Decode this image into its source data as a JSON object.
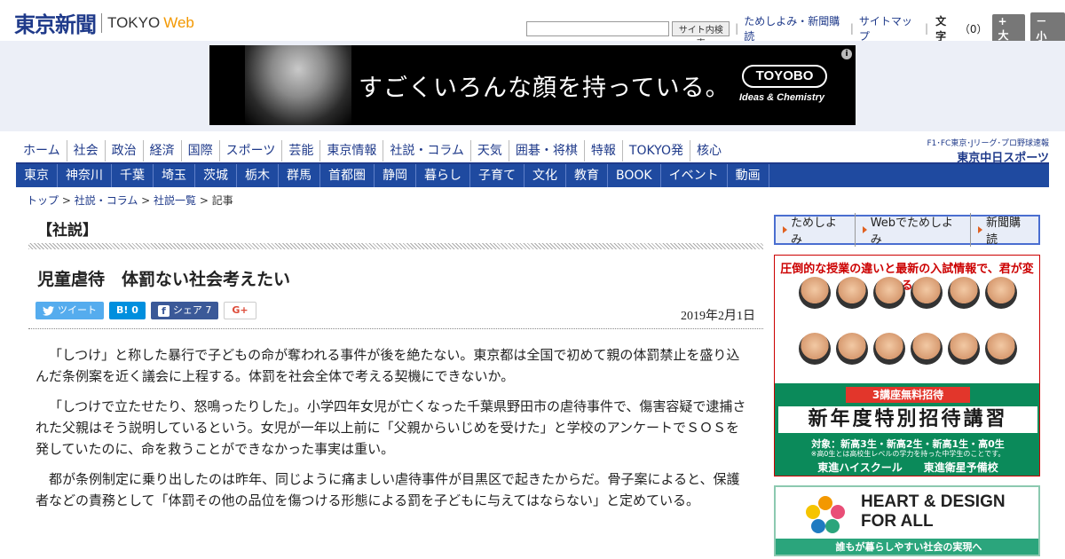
{
  "header": {
    "logo_jp": "東京新聞",
    "logo_tokyo": "TOKYO",
    "logo_web": "Web",
    "search_placeholder": "",
    "search_button": "サイト内検索",
    "links": [
      "ためしよみ・新聞購読",
      "サイトマップ"
    ],
    "moji_label": "文字",
    "moji_value": "（0）",
    "size_up": "+ 大",
    "size_down": "－ 小"
  },
  "banner": {
    "text": "すごくいろんな顔を持っている。",
    "brand": "TOYOBO",
    "tagline": "Ideas & Chemistry",
    "info": "i"
  },
  "nav_main": [
    "ホーム",
    "社会",
    "政治",
    "経済",
    "国際",
    "スポーツ",
    "芸能",
    "東京情報",
    "社説・コラム",
    "天気",
    "囲碁・将棋",
    "特報",
    "TOKYO発",
    "核心"
  ],
  "chunichi": {
    "small": "F1･FC東京･Jリーグ･プロ野球速報",
    "big": "東京中日スポーツ"
  },
  "nav_sub": [
    "東京",
    "神奈川",
    "千葉",
    "埼玉",
    "茨城",
    "栃木",
    "群馬",
    "首都圏",
    "静岡",
    "暮らし",
    "子育て",
    "文化",
    "教育",
    "BOOK",
    "イベント",
    "動画"
  ],
  "breadcrumb": {
    "items": [
      "トップ",
      "社説・コラム",
      "社説一覧"
    ],
    "current": "記事",
    "sep": " > "
  },
  "section_title": "【社説】",
  "article": {
    "title": "児童虐待　体罰ない社会考えたい",
    "date": "2019年2月1日",
    "share": {
      "tweet": "ツイート",
      "hatena": "B! 0",
      "facebook": "シェア 7",
      "gplus": "G+"
    },
    "paragraphs": [
      "「しつけ」と称した暴行で子どもの命が奪われる事件が後を絶たない。東京都は全国で初めて親の体罰禁止を盛り込んだ条例案を近く議会に上程する。体罰を社会全体で考える契機にできないか。",
      "「しつけで立たせたり、怒鳴ったりした」。小学四年女児が亡くなった千葉県野田市の虐待事件で、傷害容疑で逮捕された父親はそう説明しているという。女児が一年以上前に「父親からいじめを受けた」と学校のアンケートでＳＯＳを発していたのに、命を救うことができなかった事実は重い。",
      "都が条例制定に乗り出したのは昨年、同じように痛ましい虐待事件が目黒区で起きたからだ。骨子案によると、保護者などの責務として「体罰その他の品位を傷つける形態による罰を子どもに与えてはならない」と定めている。"
    ]
  },
  "sidebar": {
    "links": [
      "ためしよみ",
      "Webでためしよみ",
      "新聞購読"
    ],
    "ad_toshin": {
      "top": "圧倒的な授業の違いと最新の入試情報で、君が変わる。",
      "badge": "3講座無料招待",
      "big": "新年度特別招待講習",
      "target": "対象：新高3生・新高2生・新高1生・高0生",
      "note": "※高0生とは高校生レベルの学力を持った中学生のことです。",
      "brands": "東進ハイスクール　　東進衛星予備校"
    },
    "ad_heart": {
      "line1": "HEART & DESIGN",
      "line2": "FOR ALL",
      "footer": "誰もが暮らしやすい社会の実現へ"
    }
  }
}
